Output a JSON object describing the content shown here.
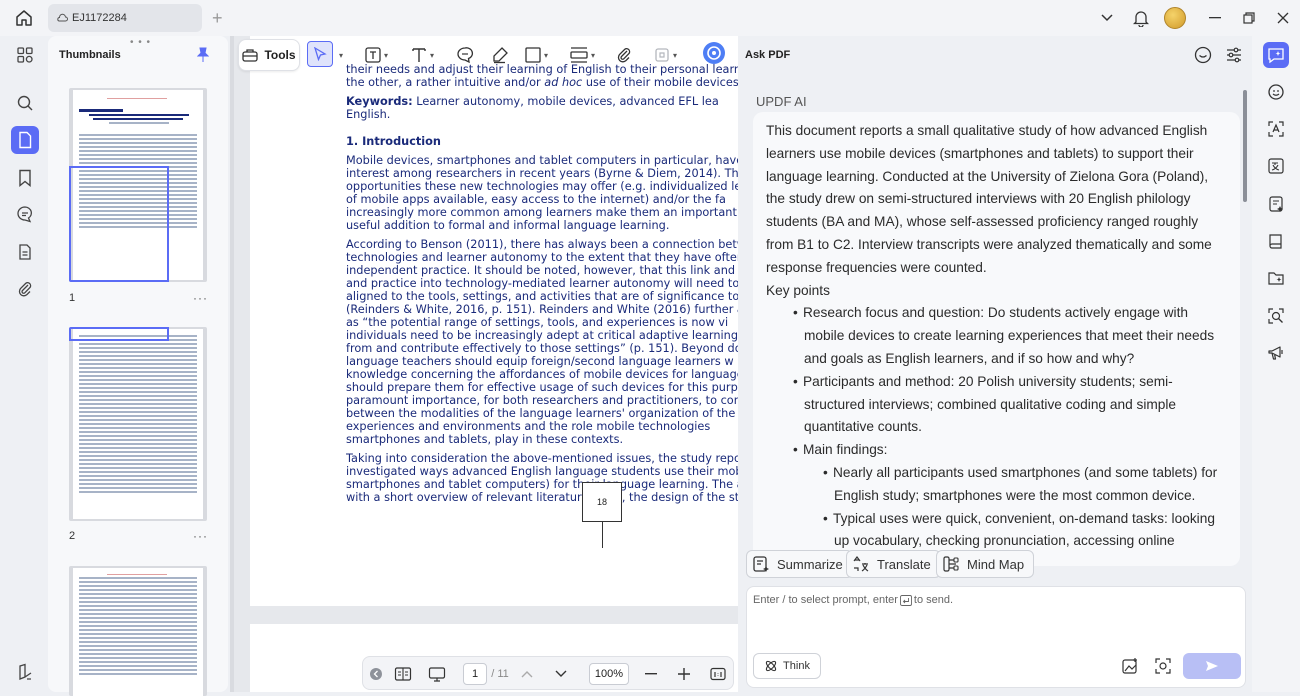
{
  "window": {
    "tab_title": "EJ1172284",
    "new_tab_symbol": "+"
  },
  "thumbnails": {
    "title": "Thumbnails",
    "pages": [
      {
        "number": "1",
        "more": "···"
      },
      {
        "number": "2",
        "more": "···"
      }
    ]
  },
  "toolbar": {
    "tools_label": "Tools"
  },
  "document": {
    "lines_top": [
      "their needs and adjust their learning of English to their personal learnin",
      "the other, a rather intuitive and/or ad hoc use of their mobile devices in"
    ],
    "keywords_label": "Keywords:",
    "keywords_text": " Learner autonomy, mobile devices, advanced EFL lea",
    "keywords_line2": "English.",
    "section_heading": "1. Introduction",
    "para1": [
      "Mobile devices, smartphones and tablet computers in particular, have g",
      "interest among researchers in recent years (Byrne & Diem, 2014). Thi",
      "opportunities these new technologies may offer (e.g. individualized lear",
      "of mobile apps available, easy access to the internet) and/or the fa",
      "increasingly more common among learners make them an important",
      "useful addition to formal and informal language learning."
    ],
    "para2": [
      "According to Benson (2011), there has always been a connection betw",
      "technologies and learner autonomy to the extent that they have often b",
      "independent practice. It should be noted, however, that this link and",
      "and practice into technology-mediated learner autonomy will need to",
      "aligned to the tools, settings, and activities that are of significance to lar",
      "(Reinders & White, 2016, p. 151). Reinders and White (2016) further ar",
      "as “the potential range of settings, tools, and experiences is now vi",
      "individuals need to be increasingly adept at critical adaptive learning in",
      "from and contribute effectively to those settings” (p. 151). Beyond doub",
      "language teachers should equip foreign/second language learners w",
      "knowledge concerning the affordances of mobile devices for language",
      "should prepare them for effective usage of such devices for this purpo",
      "paramount importance, for both researchers and practitioners, to comp",
      "between the modalities of the language learners' organization of the",
      "experiences and environments and the role mobile technologies",
      "smartphones and tablets, play in these contexts."
    ],
    "para3": [
      "Taking into consideration the above-mentioned issues, the study report",
      "investigated ways advanced English language students use their mob",
      "smartphones and tablet computers) for their language learning. The art",
      "with a short overview of relevant literature. Next, the design of the stu"
    ],
    "page_number": "18"
  },
  "bottom_nav": {
    "current_page": "1",
    "total_pages": "/ 11",
    "zoom": "100%"
  },
  "ask_pdf": {
    "title": "Ask PDF",
    "sender": "UPDF AI",
    "summary_intro": "This document reports a small qualitative study of how advanced English learners use mobile devices (smartphones and tablets) to support their language learning. Conducted at the University of Zielona Gora (Poland), the study drew on semi-structured interviews with 20 English philology students (BA and MA), whose self-assessed proficiency ranged roughly from B1 to C2. Interview transcripts were analyzed thematically and some response frequencies were counted.",
    "key_points_label": "Key points",
    "points": [
      "Research focus and question: Do students actively engage with mobile devices to create learning experiences that meet their needs and goals as English learners, and if so how and why?",
      "Participants and method: 20 Polish university students; semi-structured interviews; combined qualitative coding and simple quantitative counts.",
      "Main findings:"
    ],
    "subpoints": [
      "Nearly all participants used smartphones (and some tablets) for English study; smartphones were the most common device.",
      "Typical uses were quick, convenient, on-demand tasks: looking up vocabulary, checking pronunciation, accessing online resources,"
    ],
    "chips": {
      "summarize": "Summarize",
      "translate": "Translate",
      "mind_map": "Mind Map"
    },
    "prompt_placeholder_a": "Enter / to select prompt, enter ",
    "prompt_placeholder_b": "to send.",
    "think_label": "Think"
  }
}
